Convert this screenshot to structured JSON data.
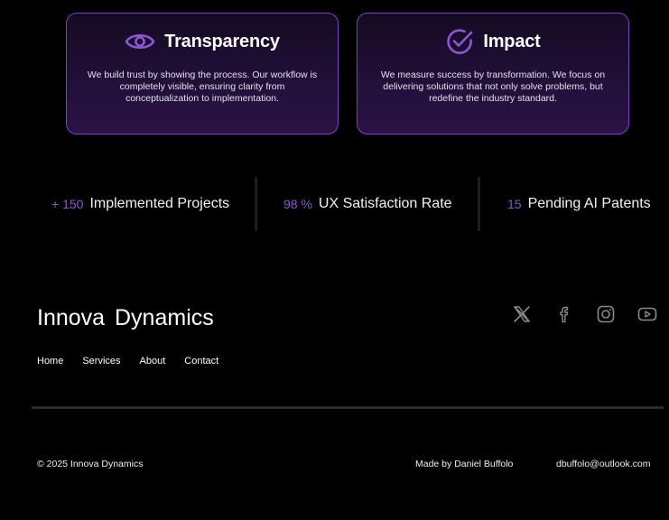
{
  "cards": [
    {
      "icon": "eye-icon",
      "title": "Transparency",
      "text": "We build trust by showing the process. Our workflow is completely visible, ensuring clarity from conceptualization to implementation."
    },
    {
      "icon": "check-circle-icon",
      "title": "Impact",
      "text": "We measure success by transformation. We focus on delivering solutions that not only solve problems, but redefine the industry standard."
    }
  ],
  "stats": [
    {
      "number": "+ 150",
      "label": "Implemented Projects"
    },
    {
      "number": "98 %",
      "label": "UX Satisfaction Rate"
    },
    {
      "number": "15",
      "label": "Pending AI Patents"
    }
  ],
  "footer": {
    "brand": "Innova Dynamics",
    "nav": [
      "Home",
      "Services",
      "About",
      "Contact"
    ],
    "social": [
      "x-icon",
      "facebook-icon",
      "instagram-icon",
      "youtube-icon"
    ],
    "copyright": "© 2025 Innova Dynamics",
    "made_by": "Made by Daniel Buffolo",
    "email": "dbuffolo@outlook.com"
  },
  "colors": {
    "accent": "#8e55d6",
    "card_border": "#7c3fc4",
    "background": "#000000"
  }
}
